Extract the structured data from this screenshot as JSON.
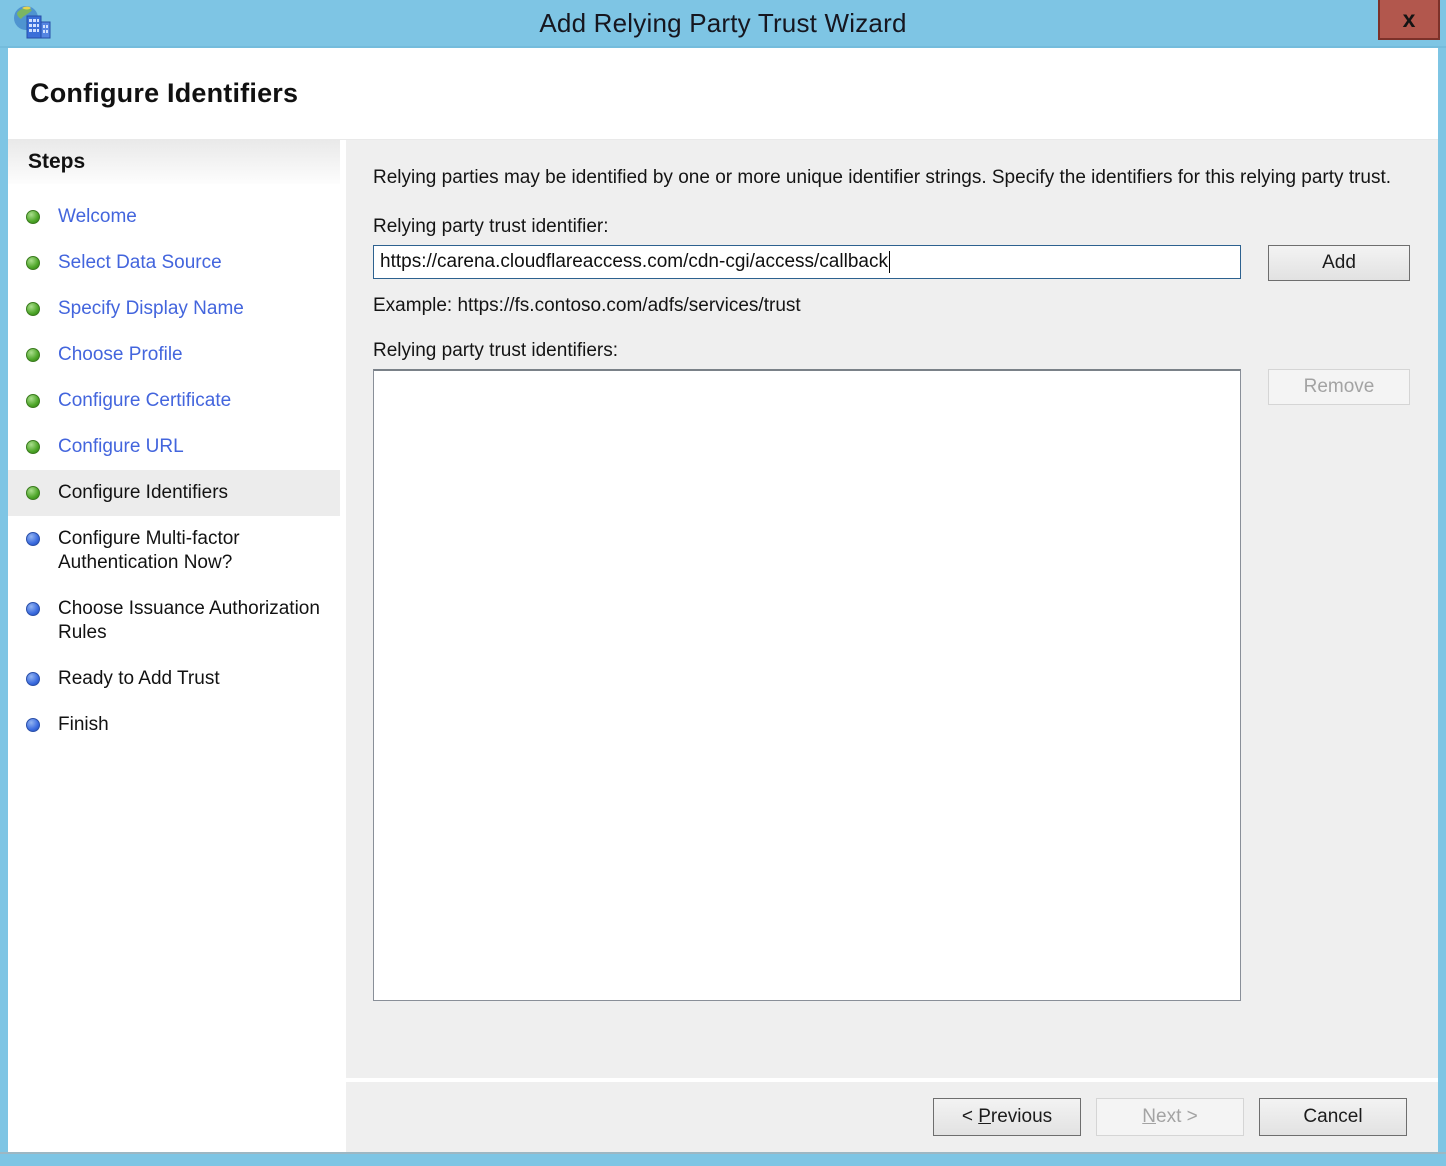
{
  "window": {
    "title": "Add Relying Party Trust Wizard",
    "close_label": "x",
    "page_title": "Configure Identifiers"
  },
  "sidebar": {
    "header": "Steps",
    "items": [
      {
        "label": "Welcome",
        "state": "completed"
      },
      {
        "label": "Select Data Source",
        "state": "completed"
      },
      {
        "label": "Specify Display Name",
        "state": "completed"
      },
      {
        "label": "Choose Profile",
        "state": "completed"
      },
      {
        "label": "Configure Certificate",
        "state": "completed"
      },
      {
        "label": "Configure URL",
        "state": "completed"
      },
      {
        "label": "Configure Identifiers",
        "state": "current"
      },
      {
        "label": "Configure Multi-factor Authentication Now?",
        "state": "upcoming"
      },
      {
        "label": "Choose Issuance Authorization Rules",
        "state": "upcoming"
      },
      {
        "label": "Ready to Add Trust",
        "state": "upcoming"
      },
      {
        "label": "Finish",
        "state": "upcoming"
      }
    ]
  },
  "main": {
    "intro": "Relying parties may be identified by one or more unique identifier strings. Specify the identifiers for this relying party trust.",
    "identifier_label": "Relying party trust identifier:",
    "identifier_value": "https://carena.cloudflareaccess.com/cdn-cgi/access/callback",
    "add_label": "Add",
    "example": "Example: https://fs.contoso.com/adfs/services/trust",
    "identifiers_label": "Relying party trust identifiers:",
    "identifiers_list": [],
    "remove_label": "Remove"
  },
  "footer": {
    "previous": {
      "prefix": "< ",
      "accel": "P",
      "rest": "revious"
    },
    "next": {
      "accel": "N",
      "rest": "ext >"
    },
    "cancel_label": "Cancel"
  },
  "colors": {
    "titlebar_blue": "#7ec5e4",
    "close_red": "#b2574d",
    "link_blue": "#4365dd",
    "bullet_green": "#4ea629",
    "bullet_blue": "#3c6ce0",
    "current_step_highlight": "#ececec",
    "content_gray": "#efefef",
    "focused_input_border": "#2d618f"
  }
}
